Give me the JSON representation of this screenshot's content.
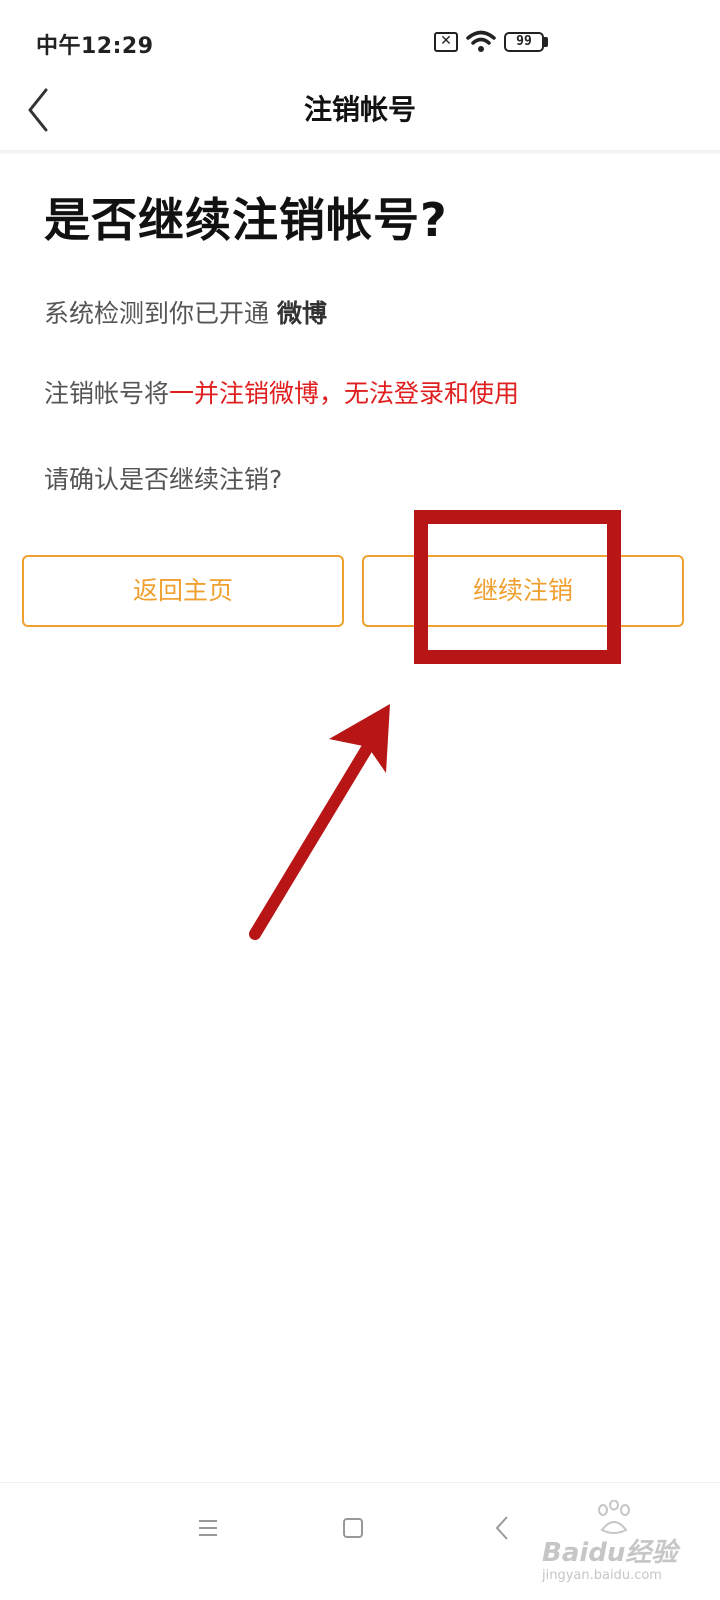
{
  "status_bar": {
    "time": "中午12:29",
    "sim_icon": "sim-no-service-icon",
    "sim_glyph": "✕",
    "wifi_icon": "wifi-icon",
    "battery_level": "99"
  },
  "nav": {
    "title": "注销帐号",
    "back_icon": "chevron-left-icon"
  },
  "main": {
    "heading": "是否继续注销帐号?",
    "detected_prefix": "系统检测到你已开通 ",
    "detected_service": "微博",
    "warning_prefix": "注销帐号将",
    "warning_text": "一并注销微博，无法登录和使用",
    "confirm_text": "请确认是否继续注销?"
  },
  "buttons": {
    "home_label": "返回主页",
    "continue_label": "继续注销"
  },
  "system_nav": {
    "menu_icon": "menu-icon",
    "home_icon": "square-home-icon",
    "back_icon": "back-triangle-icon"
  },
  "watermark": {
    "logo": "Baidu经验",
    "url": "jingyan.baidu.com"
  },
  "colors": {
    "accent": "#f0a030",
    "warning": "#e02020",
    "annotation": "#b81616"
  }
}
